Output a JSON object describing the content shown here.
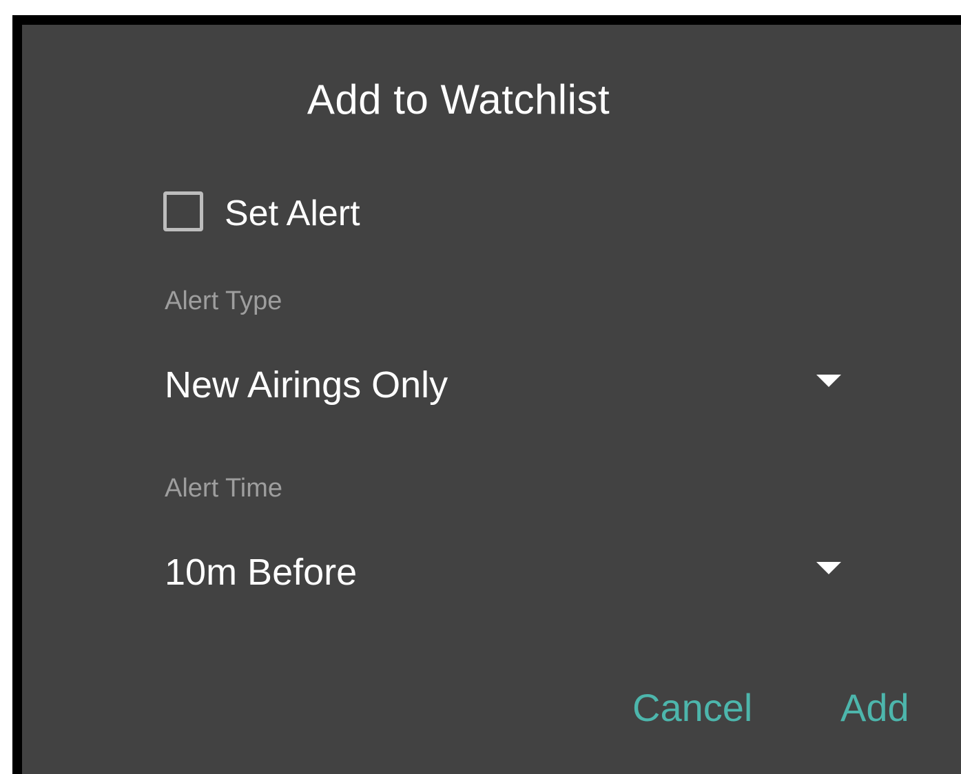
{
  "dialog": {
    "title": "Add to Watchlist",
    "set_alert": {
      "label": "Set Alert",
      "checked": false
    },
    "alert_type": {
      "label": "Alert Type",
      "selected": "New Airings Only"
    },
    "alert_time": {
      "label": "Alert Time",
      "selected": "10m Before"
    },
    "actions": {
      "cancel_label": "Cancel",
      "add_label": "Add"
    }
  },
  "colors": {
    "dialog_background": "#424242",
    "accent": "#4db6ac",
    "label_text": "#9e9e9e",
    "primary_text": "#ffffff"
  },
  "icons": {
    "checkbox": "checkbox-unchecked-icon",
    "dropdown": "dropdown-arrow-icon"
  }
}
